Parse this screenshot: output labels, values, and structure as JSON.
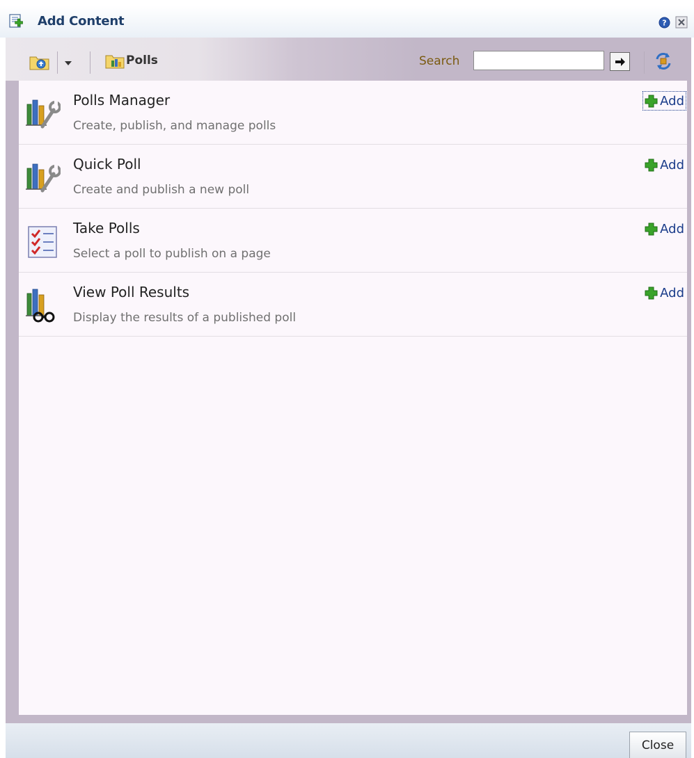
{
  "dialog": {
    "title": "Add Content",
    "help_icon": "help-icon",
    "close_icon": "close-x-icon"
  },
  "toolbar": {
    "folder_label": "Polls",
    "search_label": "Search",
    "search_value": "",
    "go_icon": "arrow-right-icon",
    "refresh_icon": "refresh-icon"
  },
  "items": [
    {
      "title": "Polls Manager",
      "description": "Create, publish, and manage polls",
      "add_label": "Add",
      "icon": "polls-manager-icon"
    },
    {
      "title": "Quick Poll",
      "description": "Create and publish a new poll",
      "add_label": "Add",
      "icon": "quick-poll-icon"
    },
    {
      "title": "Take Polls",
      "description": "Select a poll to publish on a page",
      "add_label": "Add",
      "icon": "checklist-icon"
    },
    {
      "title": "View Poll Results",
      "description": "Display the results of a published poll",
      "add_label": "Add",
      "icon": "view-results-icon"
    }
  ],
  "footer": {
    "close_label": "Close"
  },
  "colors": {
    "title_text": "#1f3f6a",
    "frame": "#c2b7c8",
    "list_bg": "#fcf7fc",
    "link": "#1a3c8a",
    "search_label": "#7a5a10"
  }
}
